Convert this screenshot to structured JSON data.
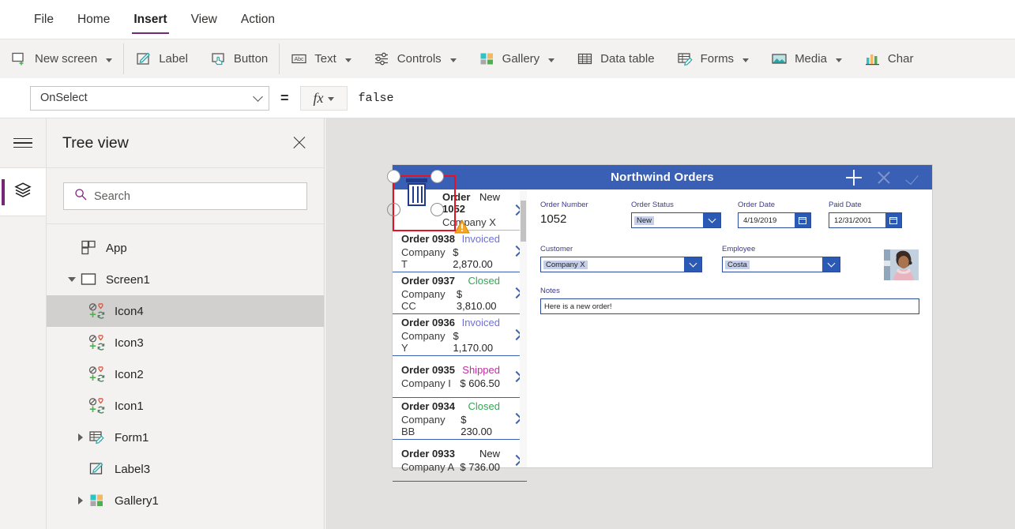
{
  "menu": {
    "items": [
      {
        "label": "File",
        "active": false
      },
      {
        "label": "Home",
        "active": false
      },
      {
        "label": "Insert",
        "active": true
      },
      {
        "label": "View",
        "active": false
      },
      {
        "label": "Action",
        "active": false
      }
    ]
  },
  "ribbon": {
    "buttons": [
      {
        "label": "New screen",
        "icon": "new-screen-icon",
        "caret": true
      },
      {
        "label": "Label",
        "icon": "label-icon",
        "caret": false
      },
      {
        "label": "Button",
        "icon": "button-icon",
        "caret": false
      },
      {
        "label": "Text",
        "icon": "text-abc-icon",
        "caret": true
      },
      {
        "label": "Controls",
        "icon": "controls-sliders-icon",
        "caret": true
      },
      {
        "label": "Gallery",
        "icon": "gallery-grid-icon",
        "caret": true
      },
      {
        "label": "Data table",
        "icon": "data-table-icon",
        "caret": false
      },
      {
        "label": "Forms",
        "icon": "forms-icon",
        "caret": true
      },
      {
        "label": "Media",
        "icon": "media-image-icon",
        "caret": true
      },
      {
        "label": "Char",
        "icon": "charts-bar-icon",
        "caret": false
      }
    ]
  },
  "formula_bar": {
    "property": "OnSelect",
    "equals": "=",
    "fx_label": "fx",
    "formula": "false"
  },
  "rail": {
    "hamburger": "hamburger-icon",
    "active_tab": "tree-view-layers-icon",
    "accent": "#742774"
  },
  "tree": {
    "title": "Tree view",
    "close": "close-icon",
    "search": {
      "placeholder": "Search",
      "value": ""
    },
    "rows": [
      {
        "label": "App",
        "indent": 0,
        "arrow": "none",
        "icon": "app-icon",
        "selected": false
      },
      {
        "label": "Screen1",
        "indent": 0,
        "arrow": "down",
        "icon": "screen-icon",
        "selected": false
      },
      {
        "label": "Icon4",
        "indent": 1,
        "arrow": "none",
        "icon": "icons-icon",
        "selected": true
      },
      {
        "label": "Icon3",
        "indent": 1,
        "arrow": "none",
        "icon": "icons-icon",
        "selected": false
      },
      {
        "label": "Icon2",
        "indent": 1,
        "arrow": "none",
        "icon": "icons-icon",
        "selected": false
      },
      {
        "label": "Icon1",
        "indent": 1,
        "arrow": "none",
        "icon": "icons-icon",
        "selected": false
      },
      {
        "label": "Form1",
        "indent": 1,
        "arrow": "right",
        "icon": "form-icon",
        "selected": false
      },
      {
        "label": "Label3",
        "indent": 1,
        "arrow": "none",
        "icon": "label-icon",
        "selected": false
      },
      {
        "label": "Gallery1",
        "indent": 1,
        "arrow": "right",
        "icon": "gallery-icon",
        "selected": false
      }
    ]
  },
  "app_preview": {
    "header": {
      "title": "Northwind Orders",
      "background": "#3a60b5",
      "actions": [
        {
          "name": "add-icon",
          "state": "enabled"
        },
        {
          "name": "cancel-icon",
          "state": "dimmed"
        },
        {
          "name": "check-icon",
          "state": "dimmed"
        }
      ]
    },
    "gallery": {
      "selected_label_order": "Order 1052",
      "selected_label_company": "Company X",
      "selected_status": "New",
      "selection_color": "#e81123",
      "selected_control_icon": "trash-icon",
      "warning_icon": "warning-triangle-icon",
      "rows": [
        {
          "order": "Order 0938",
          "company": "Company T",
          "status": "Invoiced",
          "amount": "$ 2,870.00",
          "status_color": "#6f6fd8"
        },
        {
          "order": "Order 0937",
          "company": "Company CC",
          "status": "Closed",
          "amount": "$ 3,810.00",
          "status_color": "#32a852"
        },
        {
          "order": "Order 0936",
          "company": "Company Y",
          "status": "Invoiced",
          "amount": "$ 1,170.00",
          "status_color": "#6f6fd8"
        },
        {
          "order": "Order 0935",
          "company": "Company I",
          "status": "Shipped",
          "amount": "$ 606.50",
          "status_color": "#c02fa0"
        },
        {
          "order": "Order 0934",
          "company": "Company BB",
          "status": "Closed",
          "amount": "$ 230.00",
          "status_color": "#32a852"
        },
        {
          "order": "Order 0933",
          "company": "Company A",
          "status": "New",
          "amount": "$ 736.00",
          "status_color": "#262524"
        }
      ]
    },
    "form": {
      "order_number": {
        "label": "Order Number",
        "value": "1052"
      },
      "order_status": {
        "label": "Order Status",
        "value": "New"
      },
      "order_date": {
        "label": "Order Date",
        "value": "4/19/2019"
      },
      "paid_date": {
        "label": "Paid Date",
        "value": "12/31/2001"
      },
      "customer": {
        "label": "Customer",
        "value": "Company X"
      },
      "employee": {
        "label": "Employee",
        "value": "Costa"
      },
      "notes": {
        "label": "Notes",
        "value": "Here is a new order!"
      },
      "employee_photo": "employee-avatar"
    }
  }
}
